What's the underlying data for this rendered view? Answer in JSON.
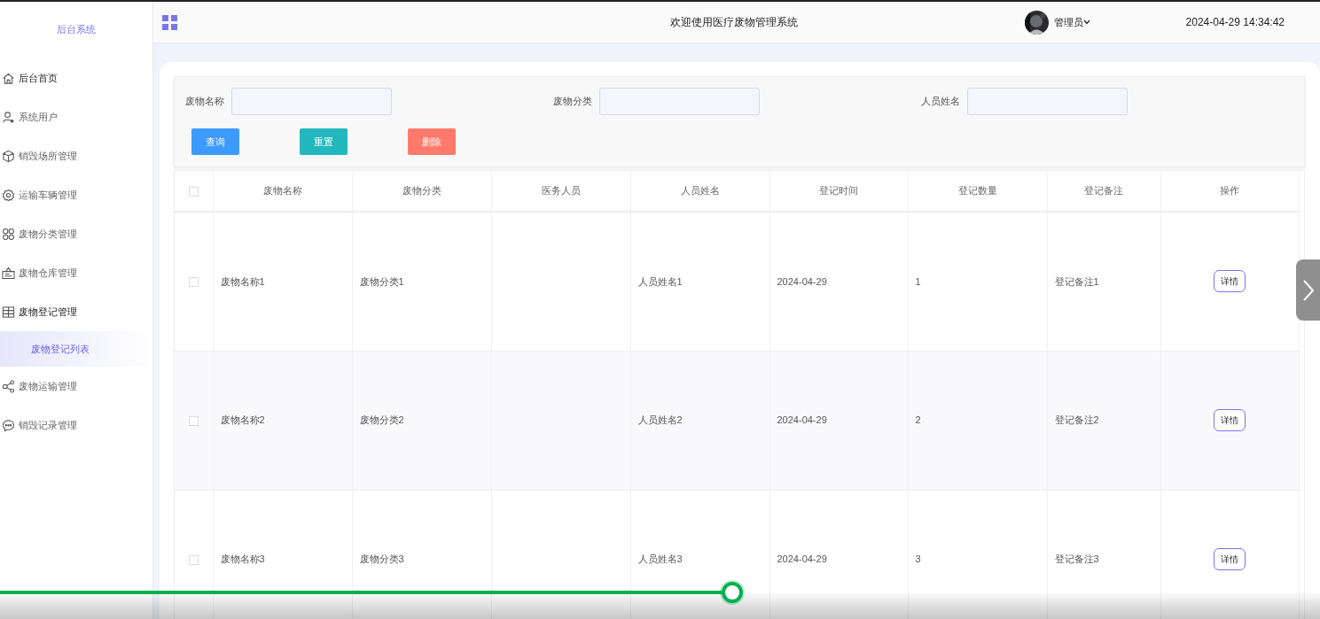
{
  "sidebar": {
    "title": "后台系统",
    "items": [
      {
        "label": "后台首页"
      },
      {
        "label": "系统用户"
      },
      {
        "label": "销毁场所管理"
      },
      {
        "label": "运输车辆管理"
      },
      {
        "label": "废物分类管理"
      },
      {
        "label": "废物仓库管理"
      },
      {
        "label": "废物登记管理",
        "children": [
          {
            "label": "废物登记列表",
            "selected": true
          }
        ]
      },
      {
        "label": "废物运输管理"
      },
      {
        "label": "销毁记录管理"
      }
    ]
  },
  "header": {
    "title": "欢迎使用医疗废物管理系统",
    "user": "管理员",
    "datetime": "2024-04-29 14:34:42"
  },
  "search": {
    "fields": [
      {
        "label": "废物名称"
      },
      {
        "label": "废物分类"
      },
      {
        "label": "人员姓名"
      }
    ],
    "buttons": [
      {
        "label": "查询",
        "kind": "primary"
      },
      {
        "label": "重置",
        "kind": "reset"
      },
      {
        "label": "删除",
        "kind": "danger"
      }
    ]
  },
  "table": {
    "all_checked": false,
    "columns": [
      "废物名称",
      "废物分类",
      "医务人员",
      "人员姓名",
      "登记时间",
      "登记数量",
      "登记备注",
      "操作"
    ],
    "rows": [
      {
        "checked": false,
        "cells": [
          "废物名称1",
          "废物分类1",
          "",
          "人员姓名1",
          "2024-04-29",
          "1",
          "登记备注1"
        ],
        "action": "详情"
      },
      {
        "checked": false,
        "cells": [
          "废物名称2",
          "废物分类2",
          "",
          "人员姓名2",
          "2024-04-29",
          "2",
          "登记备注2"
        ],
        "action": "详情"
      },
      {
        "checked": false,
        "cells": [
          "废物名称3",
          "废物分类3",
          "",
          "人员姓名3",
          "2024-04-29",
          "3",
          "登记备注3"
        ],
        "action": "详情"
      }
    ]
  },
  "player": {
    "level": 0.555
  }
}
